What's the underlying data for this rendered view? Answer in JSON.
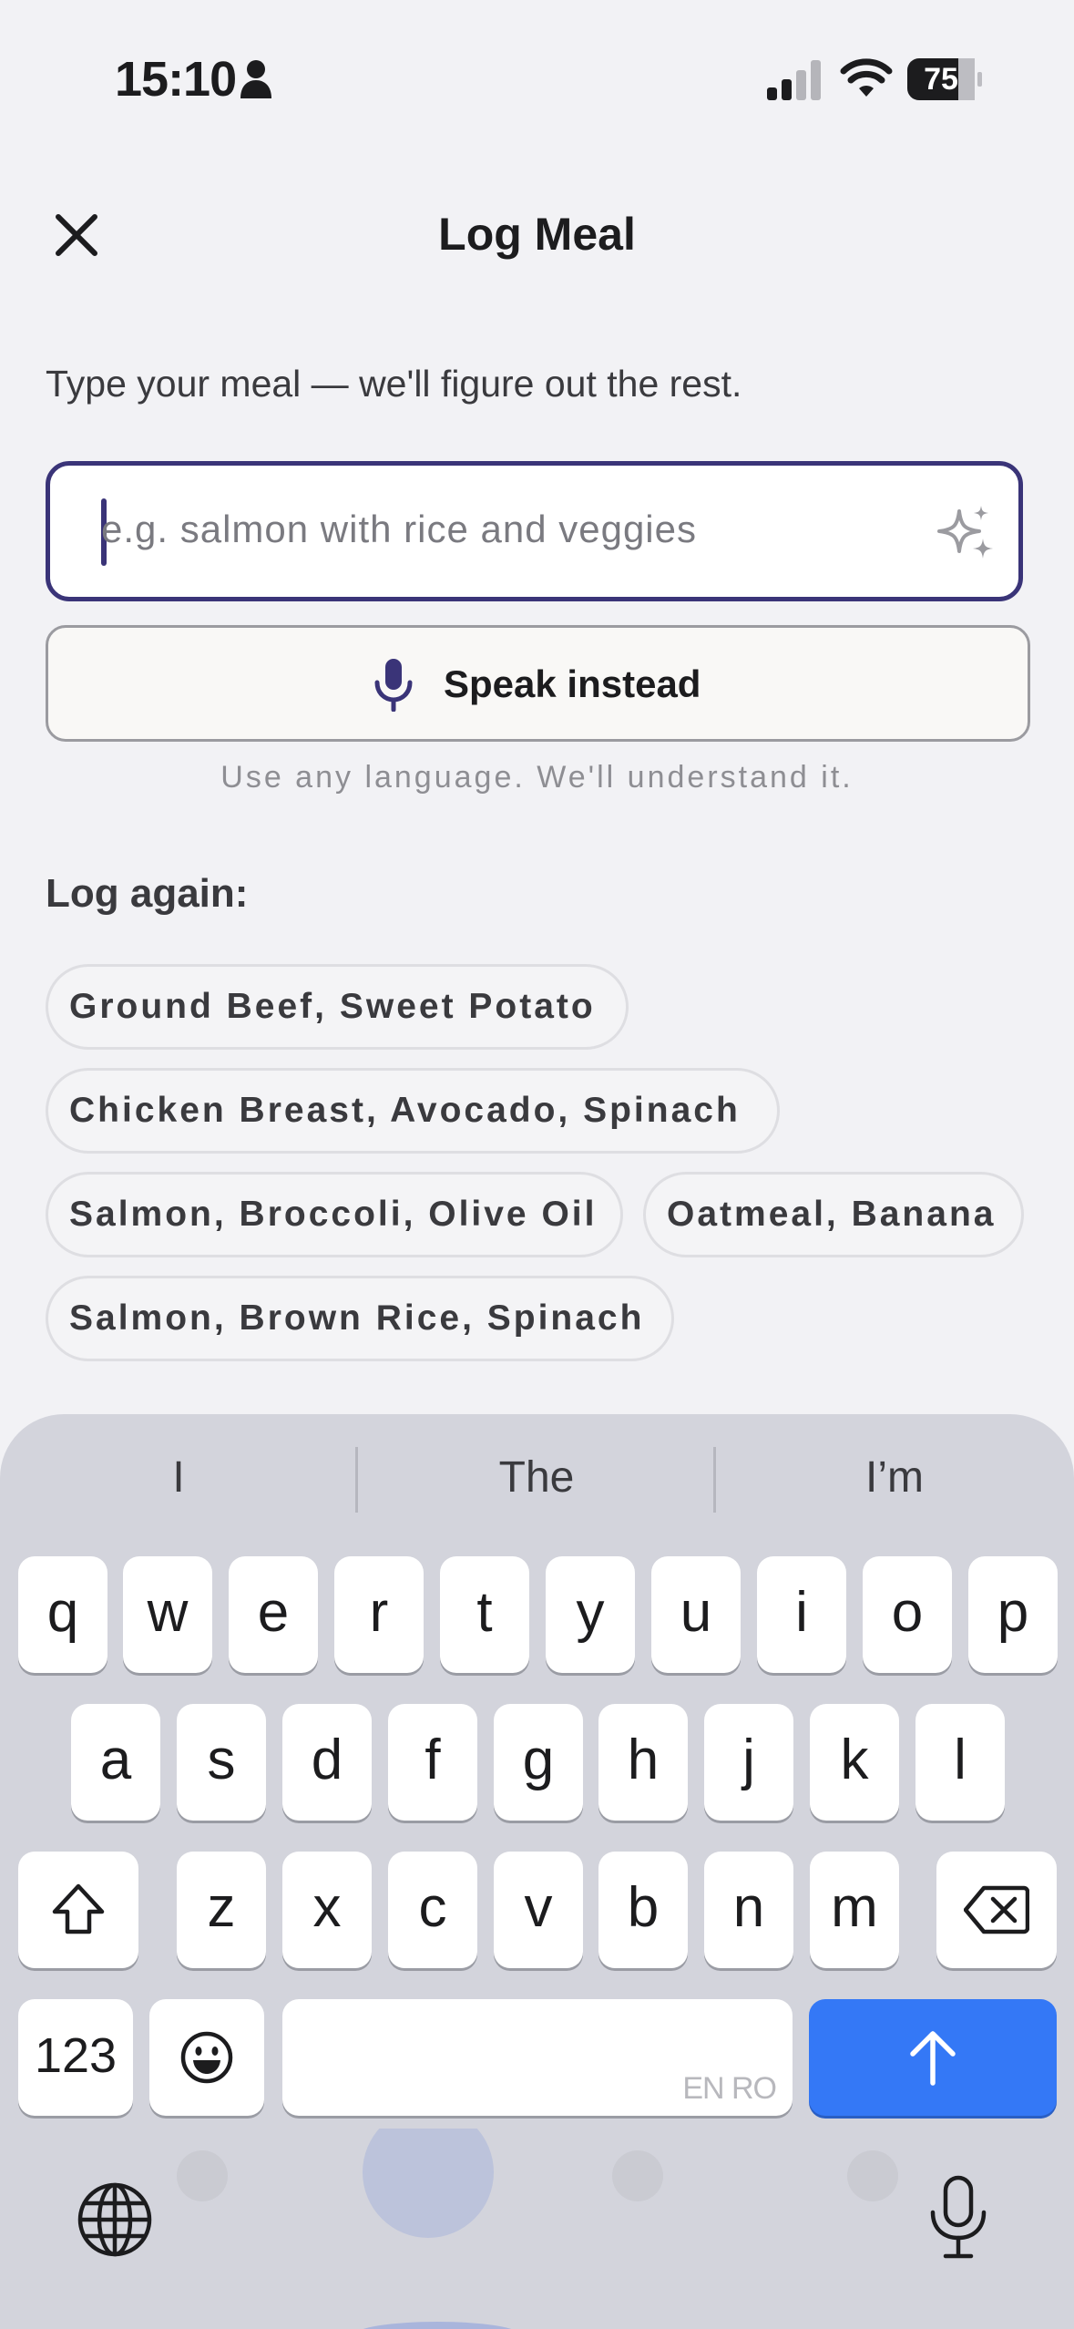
{
  "status_bar": {
    "time": "15:10",
    "battery": "75"
  },
  "header": {
    "title": "Log Meal"
  },
  "instruction": "Type your meal — we'll figure out the rest.",
  "meal_input": {
    "value": "",
    "placeholder": "e.g. salmon with rice and veggies"
  },
  "speak_button": {
    "label": "Speak instead"
  },
  "hint": "Use any language. We'll understand it.",
  "log_again": {
    "heading": "Log again:",
    "chips": [
      "Ground Beef, Sweet Potato",
      "Chicken Breast, Avocado, Spinach",
      "Salmon, Broccoli, Olive Oil",
      "Oatmeal, Banana",
      "Salmon, Brown Rice, Spinach"
    ]
  },
  "keyboard": {
    "suggestions": [
      "I",
      "The",
      "I’m"
    ],
    "row1": [
      "q",
      "w",
      "e",
      "r",
      "t",
      "y",
      "u",
      "i",
      "o",
      "p"
    ],
    "row2": [
      "a",
      "s",
      "d",
      "f",
      "g",
      "h",
      "j",
      "k",
      "l"
    ],
    "row3": [
      "z",
      "x",
      "c",
      "v",
      "b",
      "n",
      "m"
    ],
    "numbers_key": "123",
    "space_languages": "EN RO",
    "icons": [
      "shift-icon",
      "backspace-icon",
      "emoji-icon",
      "return-arrow-icon",
      "globe-icon",
      "dictation-mic-icon"
    ]
  },
  "colors": {
    "accent": "#3a3478",
    "return_key": "#3478f6",
    "background": "#f2f2f5",
    "keyboard": "#d3d4dc"
  }
}
